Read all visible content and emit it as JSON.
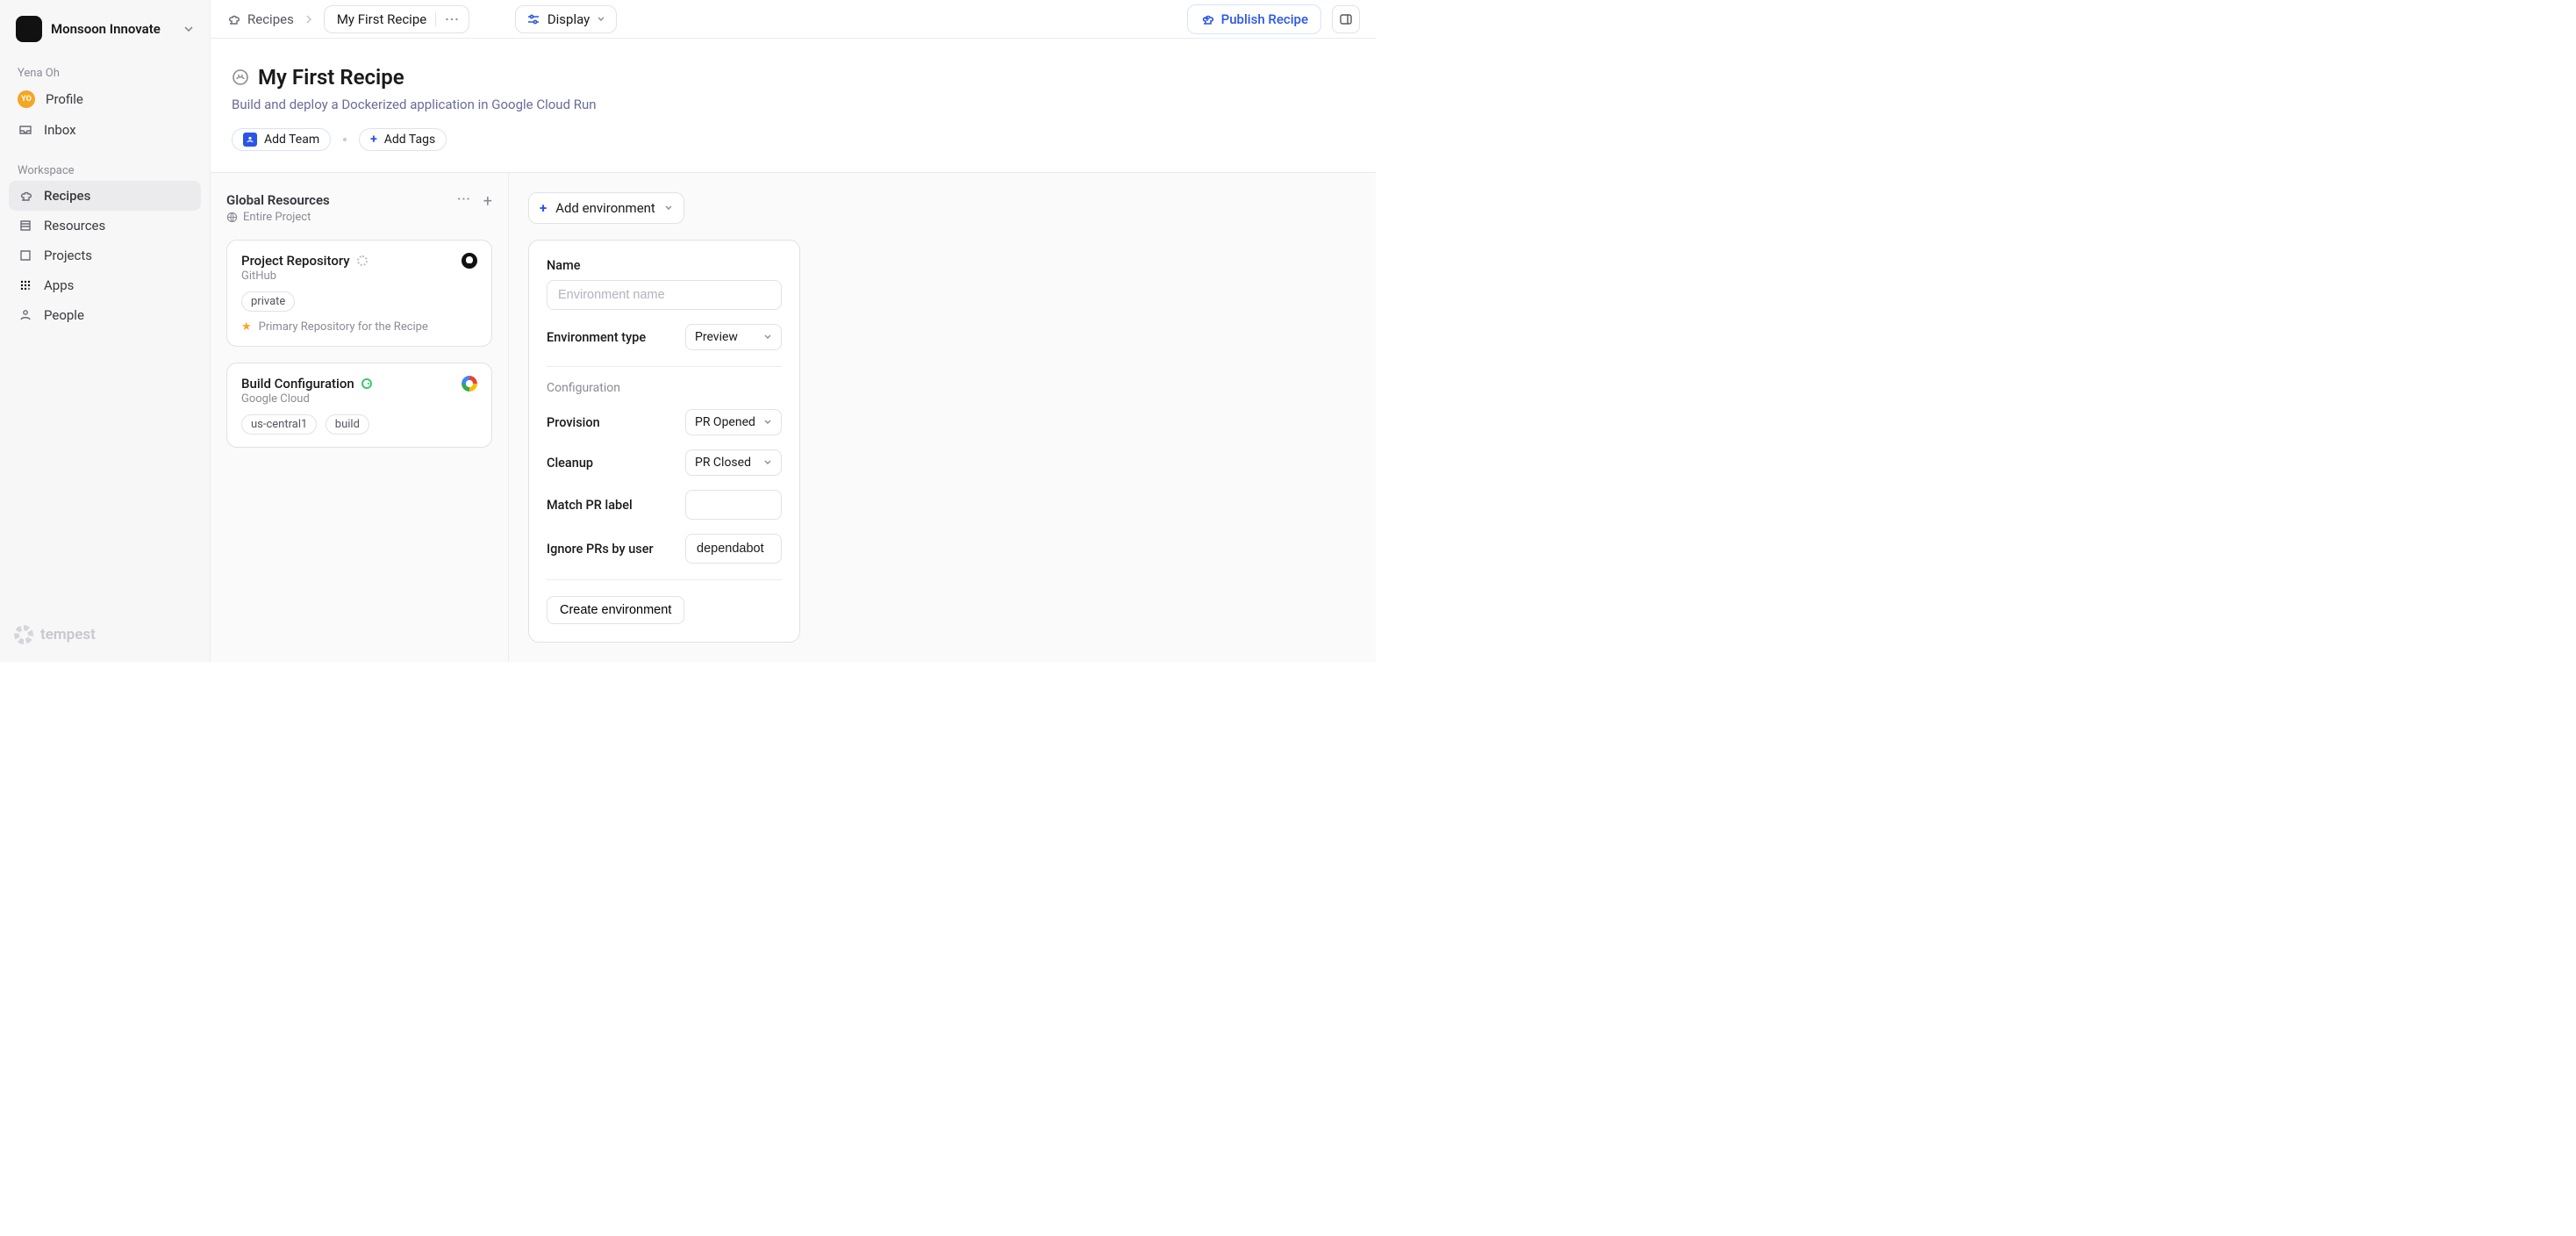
{
  "org": {
    "name": "Monsoon Innovate"
  },
  "user": {
    "name": "Yena Oh",
    "initials": "YO"
  },
  "sidebar": {
    "user_section": "Yena Oh",
    "profile": "Profile",
    "inbox": "Inbox",
    "workspace_label": "Workspace",
    "items": [
      {
        "label": "Recipes",
        "active": true
      },
      {
        "label": "Resources",
        "active": false
      },
      {
        "label": "Projects",
        "active": false
      },
      {
        "label": "Apps",
        "active": false
      },
      {
        "label": "People",
        "active": false
      }
    ],
    "brand": "tempest"
  },
  "breadcrumb": {
    "root": "Recipes",
    "current": "My First Recipe",
    "display": "Display",
    "publish": "Publish Recipe"
  },
  "page": {
    "title": "My First Recipe",
    "description": "Build and deploy a Dockerized application in Google Cloud Run",
    "add_team": "Add Team",
    "add_tags": "Add Tags"
  },
  "global_resources": {
    "title": "Global Resources",
    "scope": "Entire Project",
    "cards": [
      {
        "title": "Project Repository",
        "provider": "GitHub",
        "tags": [
          "private"
        ],
        "primary_note": "Primary Repository for the Recipe"
      },
      {
        "title": "Build Configuration",
        "provider": "Google Cloud",
        "tags": [
          "us-central1",
          "build"
        ]
      }
    ]
  },
  "env": {
    "add_label": "Add environment",
    "name_label": "Name",
    "name_placeholder": "Environment name",
    "type_label": "Environment type",
    "type_value": "Preview",
    "config_label": "Configuration",
    "provision_label": "Provision",
    "provision_value": "PR Opened",
    "cleanup_label": "Cleanup",
    "cleanup_value": "PR Closed",
    "match_label": "Match PR label",
    "match_value": "",
    "ignore_label": "Ignore PRs by user",
    "ignore_value": "dependabot",
    "create_label": "Create environment"
  }
}
